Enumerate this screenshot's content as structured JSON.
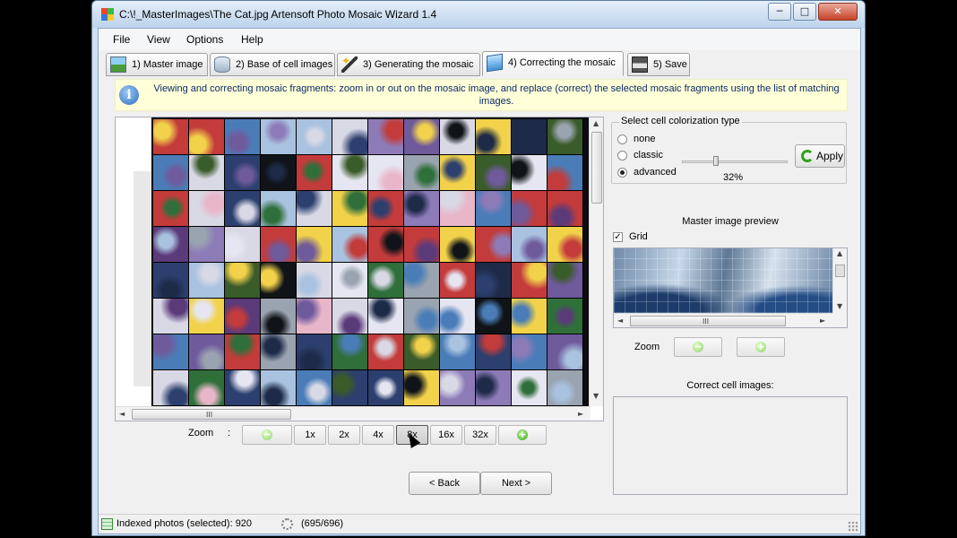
{
  "window": {
    "title": "C:\\!_MasterImages\\The Cat.jpg Artensoft Photo Mosaic Wizard 1.4",
    "minimize_glyph": "─",
    "maximize_glyph": "□",
    "close_glyph": "✕"
  },
  "menu": [
    "File",
    "View",
    "Options",
    "Help"
  ],
  "wizard_tabs": [
    {
      "label": "1) Master image",
      "icon": "picture-icon"
    },
    {
      "label": "2) Base of cell images",
      "icon": "database-icon"
    },
    {
      "label": "3) Generating the mosaic",
      "icon": "magic-wand-icon"
    },
    {
      "label": "4) Correcting the mosaic",
      "icon": "cube-icon",
      "active": true
    },
    {
      "label": "5) Save",
      "icon": "floppy-disk-icon"
    }
  ],
  "info": {
    "icon": "info-icon",
    "glyph": "i",
    "text": "Viewing and correcting mosaic fragments: zoom in or out on the mosaic image, and replace (correct) the selected mosaic fragments using the list of matching images."
  },
  "mosaic_palette": [
    "#2c3f6e",
    "#8d7bb8",
    "#d9d9e6",
    "#3a5b2a",
    "#e6e6f2",
    "#1d2a48",
    "#6f5a9c",
    "#c33b3b",
    "#f2d24a",
    "#4a7db8",
    "#a9c2e0",
    "#5b3a7a",
    "#e8b6c8",
    "#2f6f3a",
    "#9aa3b0",
    "#101418"
  ],
  "scrollbar": {
    "left_arrow": "◄",
    "right_arrow": "►",
    "up_arrow": "▲",
    "down_arrow": "▼",
    "grip": "III"
  },
  "zoom": {
    "label": "Zoom",
    "separator": ":",
    "zoom_out_glyph": "−",
    "zoom_in_glyph": "+",
    "levels": [
      "1x",
      "2x",
      "4x",
      "8x",
      "16x",
      "32x"
    ],
    "selected": "8x"
  },
  "navigation": {
    "back": "< Back",
    "next": "Next >"
  },
  "colorization": {
    "group_title": "Select cell colorization type",
    "options": [
      "none",
      "classic",
      "advanced"
    ],
    "selected": "advanced",
    "value": "32%",
    "value_fraction": 0.32,
    "apply_label": "Apply"
  },
  "preview": {
    "title": "Master image preview",
    "grid_label": "Grid",
    "grid_checked": true,
    "check_glyph": "✓",
    "zoom_label": "Zoom"
  },
  "correct": {
    "title": "Correct cell images:"
  },
  "status": {
    "indexed": "Indexed photos (selected): 920",
    "progress": "(695/696)"
  },
  "colors": {
    "accent": "#2e6fc0",
    "info_background": "#ffffd8",
    "zoom_green": "#3aa21a"
  }
}
